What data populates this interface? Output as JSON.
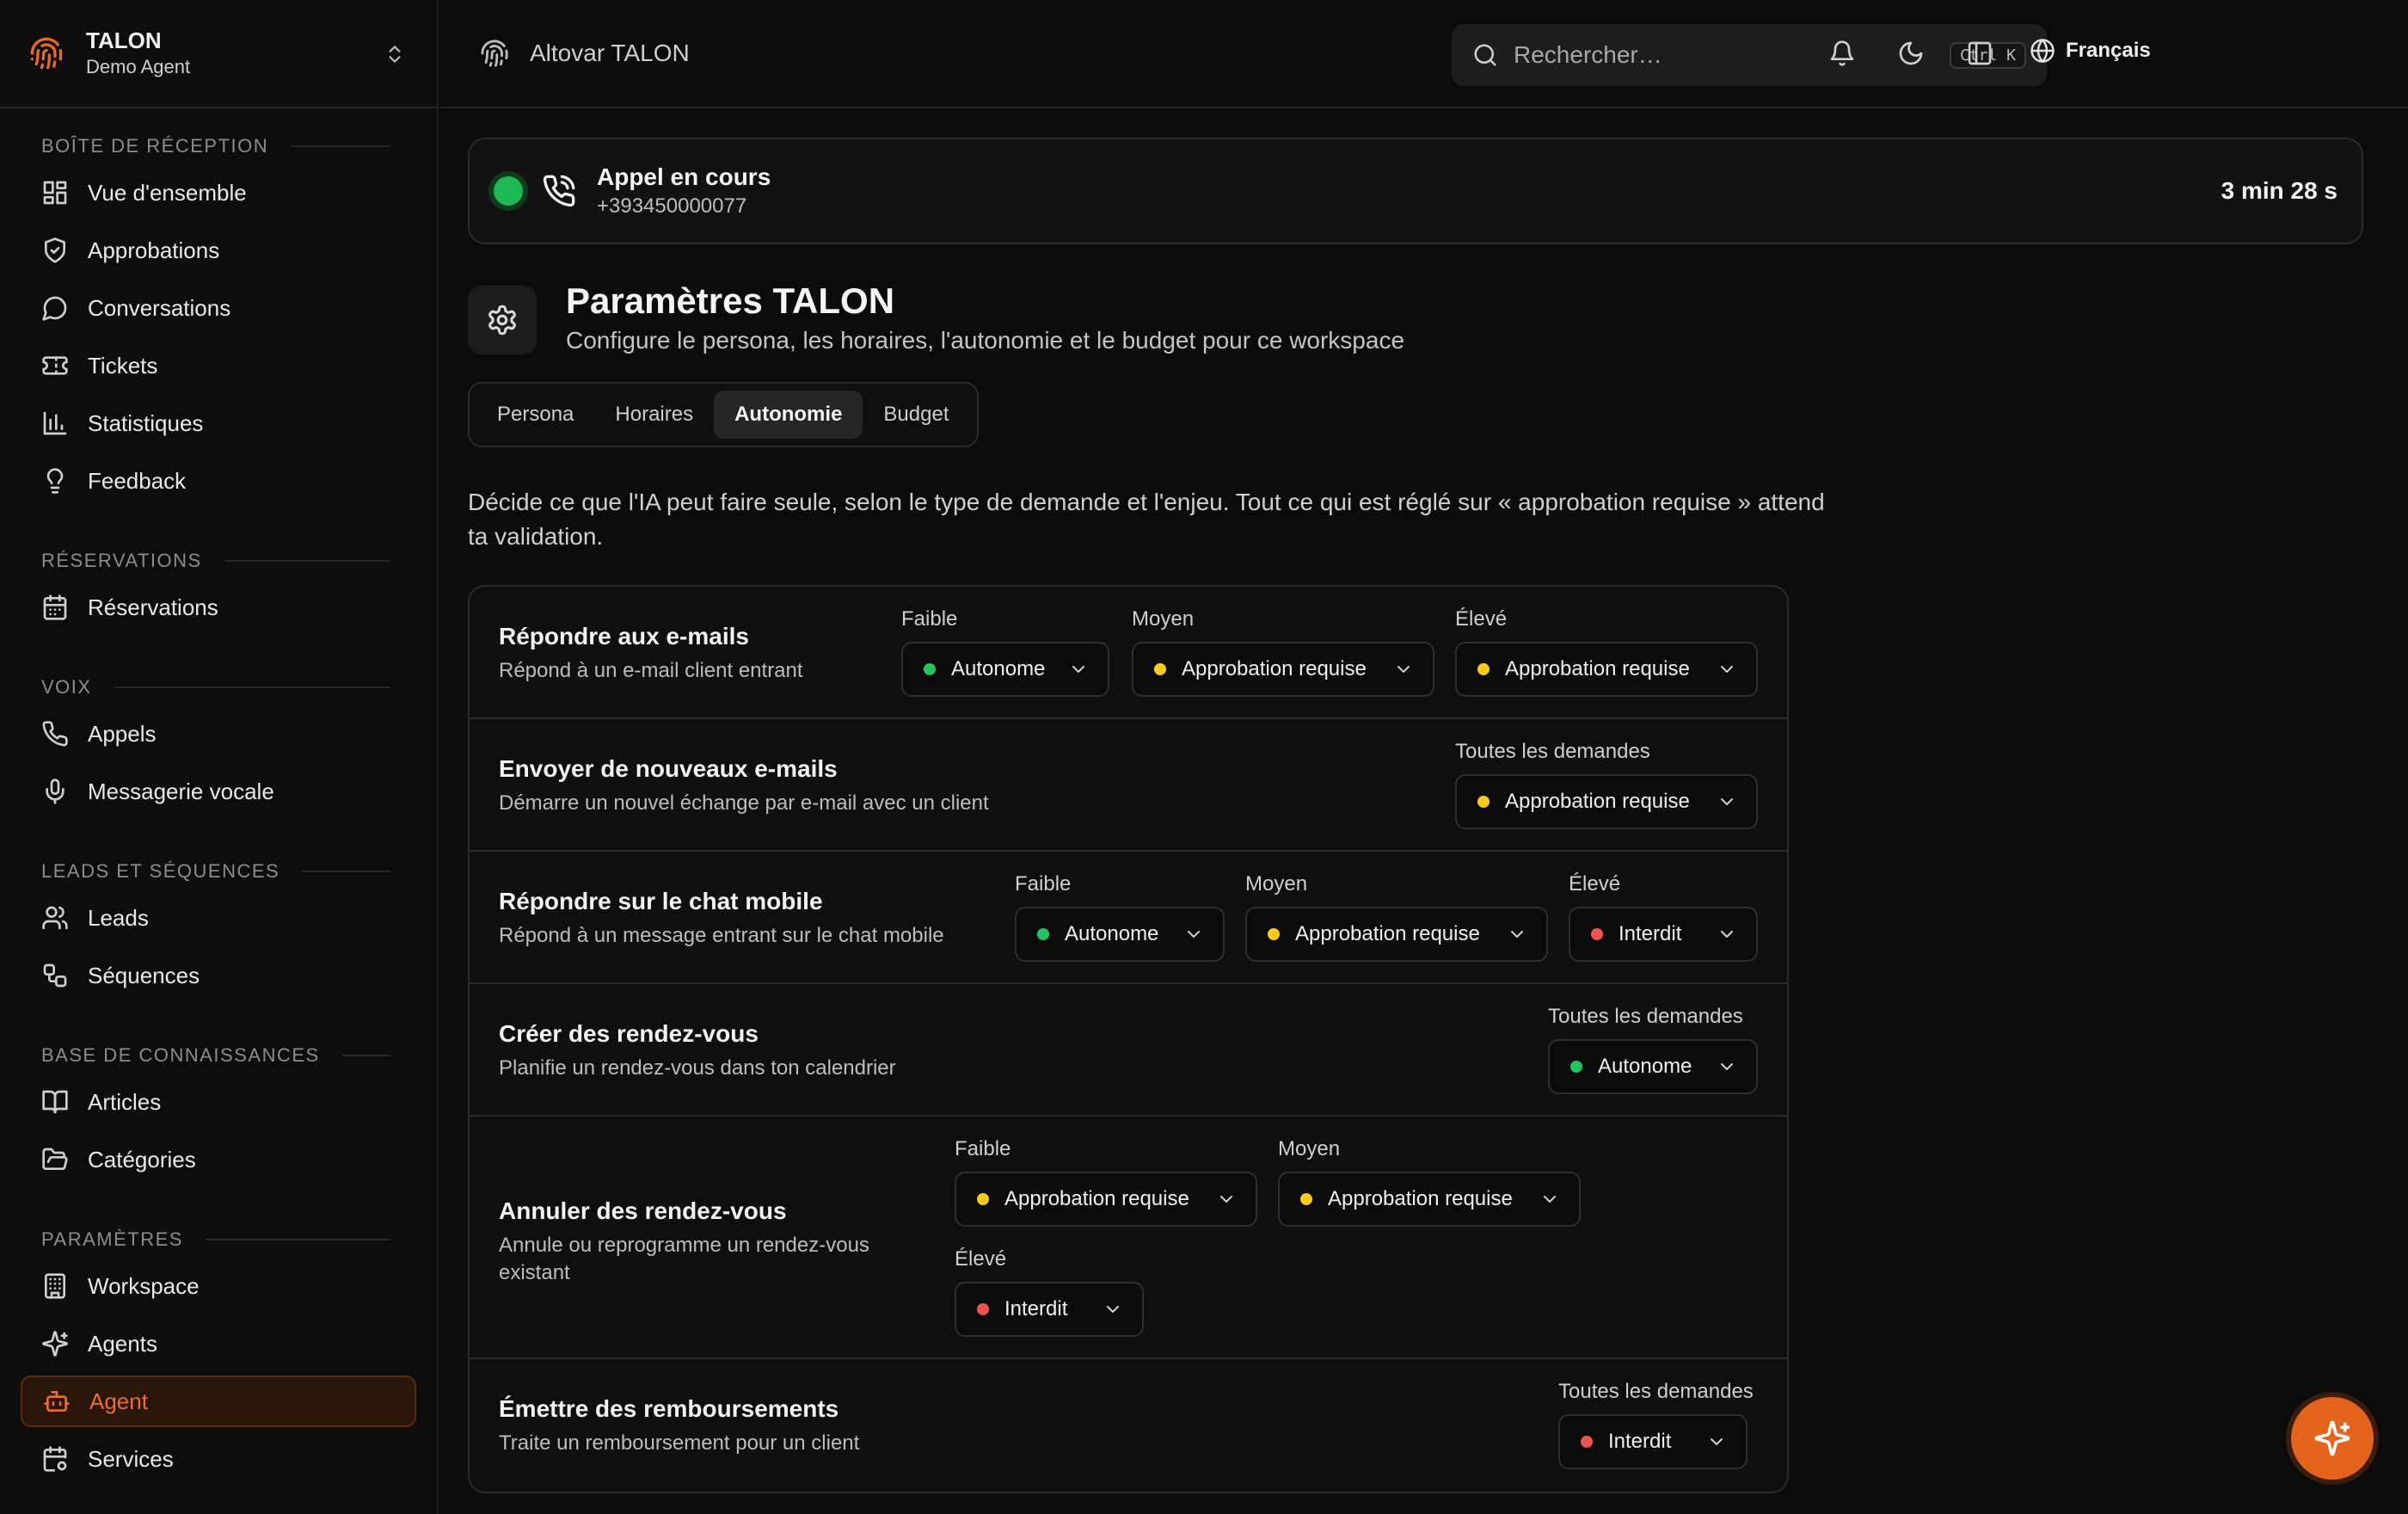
{
  "brand": {
    "title": "TALON",
    "subtitle": "Demo Agent"
  },
  "sidebar": {
    "sections": [
      {
        "label": "BOÎTE DE RÉCEPTION",
        "items": [
          {
            "label": "Vue d'ensemble",
            "icon": "layout-grid-icon"
          },
          {
            "label": "Approbations",
            "icon": "shield-icon"
          },
          {
            "label": "Conversations",
            "icon": "message-circle-icon"
          },
          {
            "label": "Tickets",
            "icon": "ticket-icon"
          },
          {
            "label": "Statistiques",
            "icon": "bar-chart-icon"
          },
          {
            "label": "Feedback",
            "icon": "lightbulb-icon"
          }
        ]
      },
      {
        "label": "RÉSERVATIONS",
        "items": [
          {
            "label": "Réservations",
            "icon": "calendar-icon"
          }
        ]
      },
      {
        "label": "VOIX",
        "items": [
          {
            "label": "Appels",
            "icon": "phone-icon"
          },
          {
            "label": "Messagerie vocale",
            "icon": "mic-icon"
          }
        ]
      },
      {
        "label": "LEADS ET SÉQUENCES",
        "items": [
          {
            "label": "Leads",
            "icon": "users-icon"
          },
          {
            "label": "Séquences",
            "icon": "workflow-icon"
          }
        ]
      },
      {
        "label": "BASE DE CONNAISSANCES",
        "items": [
          {
            "label": "Articles",
            "icon": "book-open-icon"
          },
          {
            "label": "Catégories",
            "icon": "folder-open-icon"
          }
        ]
      },
      {
        "label": "PARAMÈTRES",
        "items": [
          {
            "label": "Workspace",
            "icon": "building-icon"
          },
          {
            "label": "Agents",
            "icon": "sparkles-icon"
          },
          {
            "label": "Agent",
            "icon": "bot-icon",
            "active": true
          },
          {
            "label": "Services",
            "icon": "calendar-cog-icon"
          }
        ]
      }
    ]
  },
  "header": {
    "app_name": "Altovar TALON",
    "search_placeholder": "Rechercher…",
    "search_shortcut": "Ctrl K",
    "language": "Français"
  },
  "call": {
    "title": "Appel en cours",
    "number": "+393450000077",
    "duration": "3 min 28 s",
    "status_color": "#1db954"
  },
  "page": {
    "title": "Paramètres TALON",
    "subtitle": "Configure le persona, les horaires, l'autonomie et le budget pour ce workspace",
    "tabs": [
      "Persona",
      "Horaires",
      "Autonomie",
      "Budget"
    ],
    "active_tab": "Autonomie",
    "description": "Décide ce que l'IA peut faire seule, selon le type de demande et l'enjeu. Tout ce qui est réglé sur « approbation requise » attend ta validation."
  },
  "rules": [
    {
      "title": "Répondre aux e-mails",
      "desc": "Répond à un e-mail client entrant",
      "fields": [
        {
          "label": "Faible",
          "value": "Autonome",
          "level": "green"
        },
        {
          "label": "Moyen",
          "value": "Approbation requise",
          "level": "yellow"
        },
        {
          "label": "Élevé",
          "value": "Approbation requise",
          "level": "yellow"
        }
      ]
    },
    {
      "title": "Envoyer de nouveaux e-mails",
      "desc": "Démarre un nouvel échange par e-mail avec un client",
      "fields": [
        {
          "label": "Toutes les demandes",
          "value": "Approbation requise",
          "level": "yellow"
        }
      ]
    },
    {
      "title": "Répondre sur le chat mobile",
      "desc": "Répond à un message entrant sur le chat mobile",
      "fields": [
        {
          "label": "Faible",
          "value": "Autonome",
          "level": "green"
        },
        {
          "label": "Moyen",
          "value": "Approbation requise",
          "level": "yellow"
        },
        {
          "label": "Élevé",
          "value": "Interdit",
          "level": "red"
        }
      ]
    },
    {
      "title": "Créer des rendez-vous",
      "desc": "Planifie un rendez-vous dans ton calendrier",
      "fields": [
        {
          "label": "Toutes les demandes",
          "value": "Autonome",
          "level": "green"
        }
      ]
    },
    {
      "title": "Annuler des rendez-vous",
      "desc": "Annule ou reprogramme un rendez-vous existant",
      "fields": [
        {
          "label": "Faible",
          "value": "Approbation requise",
          "level": "yellow"
        },
        {
          "label": "Moyen",
          "value": "Approbation requise",
          "level": "yellow"
        },
        {
          "label": "Élevé",
          "value": "Interdit",
          "level": "red"
        }
      ]
    },
    {
      "title": "Émettre des remboursements",
      "desc": "Traite un remboursement pour un client",
      "fields": [
        {
          "label": "Toutes les demandes",
          "value": "Interdit",
          "level": "red"
        }
      ]
    }
  ],
  "colors": {
    "accent": "#ea6a1e",
    "green": "#22c55e",
    "yellow": "#facc15",
    "red": "#ef5350"
  }
}
